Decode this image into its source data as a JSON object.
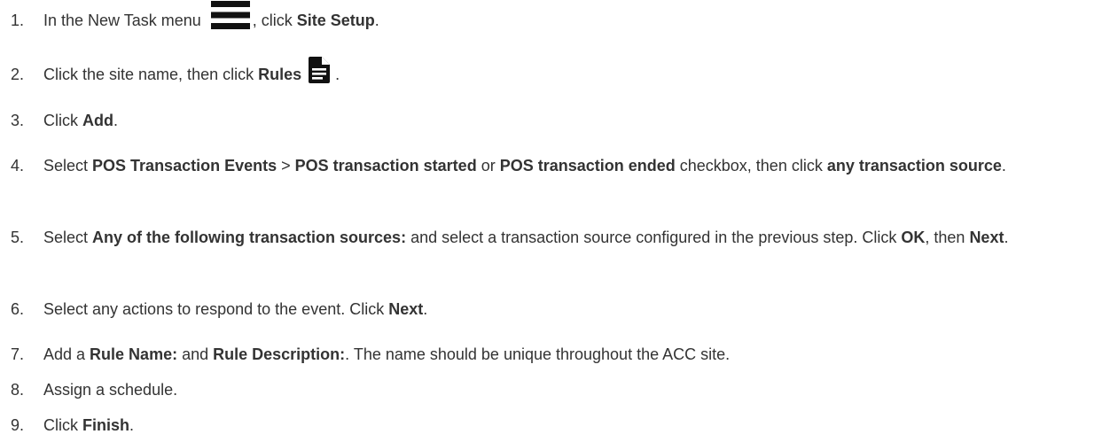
{
  "steps": [
    {
      "num": "1.",
      "parts": [
        {
          "t": "In the New Task menu "
        },
        {
          "icon": "menu-icon"
        },
        {
          "t": ", click "
        },
        {
          "b": "Site Setup"
        },
        {
          "t": "."
        }
      ]
    },
    {
      "num": "2.",
      "parts": [
        {
          "t": "Click the site name, then click "
        },
        {
          "b": "Rules"
        },
        {
          "icon": "document-icon"
        },
        {
          "t": "."
        }
      ]
    },
    {
      "num": "3.",
      "parts": [
        {
          "t": "Click "
        },
        {
          "b": "Add"
        },
        {
          "t": "."
        }
      ]
    },
    {
      "num": "4.",
      "parts": [
        {
          "t": "Select "
        },
        {
          "b": "POS Transaction Events"
        },
        {
          "t": " > "
        },
        {
          "b": "POS transaction started"
        },
        {
          "t": " or "
        },
        {
          "b": "POS transaction ended"
        },
        {
          "t": " checkbox, then click "
        },
        {
          "b": "any transaction source"
        },
        {
          "t": "."
        }
      ]
    },
    {
      "num": "5.",
      "parts": [
        {
          "t": "Select "
        },
        {
          "b": "Any of the following transaction sources:"
        },
        {
          "t": " and select a transaction source configured in the previous step. Click "
        },
        {
          "b": "OK"
        },
        {
          "t": ", then "
        },
        {
          "b": "Next"
        },
        {
          "t": "."
        }
      ]
    },
    {
      "num": "6.",
      "parts": [
        {
          "t": "Select any actions to respond to the event. Click "
        },
        {
          "b": "Next"
        },
        {
          "t": "."
        }
      ]
    },
    {
      "num": "7.",
      "parts": [
        {
          "t": "Add a "
        },
        {
          "b": "Rule Name:"
        },
        {
          "t": " and "
        },
        {
          "b": "Rule Description:"
        },
        {
          "t": ". The name should be unique throughout the ACC site."
        }
      ]
    },
    {
      "num": "8.",
      "parts": [
        {
          "t": "Assign a schedule."
        }
      ]
    },
    {
      "num": "9.",
      "parts": [
        {
          "t": "Click "
        },
        {
          "b": "Finish"
        },
        {
          "t": "."
        }
      ]
    }
  ],
  "colors": {
    "text": "#333333",
    "icon": "#111111"
  }
}
